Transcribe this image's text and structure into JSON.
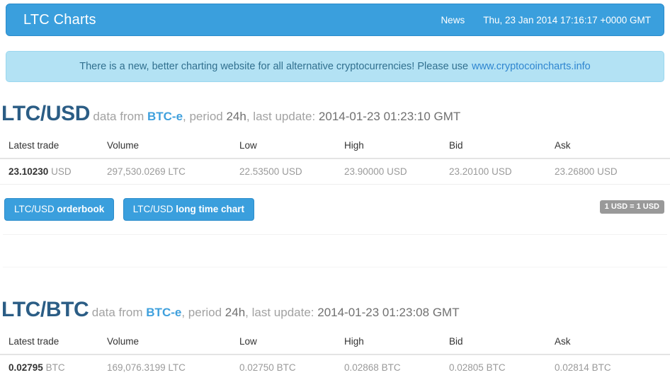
{
  "navbar": {
    "brand": "LTC Charts",
    "news_label": "News",
    "timestamp": "Thu, 23 Jan 2014 17:16:17 +0000 GMT",
    "background_color": "#3a9fdd"
  },
  "alert": {
    "text": "There is a new, better charting website for all alternative cryptocurrencies! Please use",
    "link_text": "www.cryptocoincharts.info",
    "background_color": "#b3e2f4",
    "text_color": "#31708f",
    "link_color": "#2f86d0"
  },
  "table_headers": [
    "Latest trade",
    "Volume",
    "Low",
    "High",
    "Bid",
    "Ask"
  ],
  "markets": [
    {
      "pair": "LTC/USD",
      "meta_data_from": "data from",
      "source": "BTC-e",
      "meta_period_label": ", period",
      "period": "24h",
      "meta_update_label": ", last update:",
      "last_update": "2014-01-23 01:23:10 GMT",
      "row": {
        "latest_trade_value": "23.10230",
        "latest_trade_unit": "USD",
        "volume_value": "297,530.0269",
        "volume_unit": "LTC",
        "low_value": "22.53500",
        "low_unit": "USD",
        "high_value": "23.90000",
        "high_unit": "USD",
        "bid_value": "23.20100",
        "bid_unit": "USD",
        "ask_value": "23.26800",
        "ask_unit": "USD"
      },
      "buttons": [
        {
          "prefix": "LTC/USD",
          "bold": "orderbook"
        },
        {
          "prefix": "LTC/USD",
          "bold": "long time chart"
        }
      ],
      "rate_badge": "1 USD = 1 USD"
    },
    {
      "pair": "LTC/BTC",
      "meta_data_from": "data from",
      "source": "BTC-e",
      "meta_period_label": ", period",
      "period": "24h",
      "meta_update_label": ", last update:",
      "last_update": "2014-01-23 01:23:08 GMT",
      "row": {
        "latest_trade_value": "0.02795",
        "latest_trade_unit": "BTC",
        "volume_value": "169,076.3199",
        "volume_unit": "LTC",
        "low_value": "0.02750",
        "low_unit": "BTC",
        "high_value": "0.02868",
        "high_unit": "BTC",
        "bid_value": "0.02805",
        "bid_unit": "BTC",
        "ask_value": "0.02814",
        "ask_unit": "BTC"
      }
    }
  ]
}
